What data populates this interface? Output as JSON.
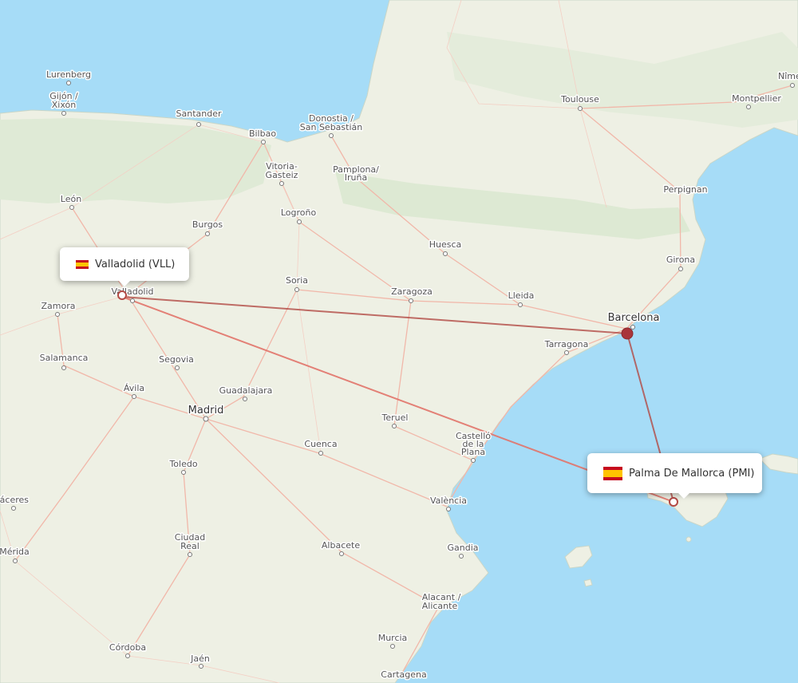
{
  "routes": [
    {
      "from": "Valladolid",
      "via": "Barcelona",
      "to": "Palma De Mallorca"
    },
    {
      "from": "Valladolid",
      "to": "Palma De Mallorca",
      "kind": "direct"
    }
  ],
  "airports": {
    "origin": {
      "label": "Valladolid (VLL)",
      "flag": "spain-flag-icon"
    },
    "destination": {
      "label": "Palma De Mallorca (PMI)",
      "flag": "spain-flag-icon"
    }
  },
  "hub": {
    "name": "Barcelona"
  },
  "cities": {
    "lurenberg": "Lurenberg",
    "gijon": "Gijón /",
    "xixon": "Xixón",
    "santander": "Santander",
    "bilbao": "Bilbao",
    "donostia": "Donostia /",
    "san_sebastian": "San Sebastián",
    "vitoria": "Vitoria-",
    "gasteiz": "Gasteiz",
    "pamplona": "Pamplona/",
    "iruna": "Iruña",
    "toulouse": "Toulouse",
    "montpellier": "Montpellier",
    "nimes": "Nîmes",
    "leon": "León",
    "burgos": "Burgos",
    "logrono": "Logroño",
    "huesca": "Huesca",
    "perpignan": "Perpignan",
    "girona": "Girona",
    "soria": "Soria",
    "zaragoza": "Zaragoza",
    "lleida": "Lleida",
    "barcelona": "Barcelona",
    "valladolid": "Valladolid",
    "zamora": "Zamora",
    "tarragona": "Tarragona",
    "salamanca": "Salamanca",
    "segovia": "Segovia",
    "avila": "Ávila",
    "guadalajara": "Guadalajara",
    "madrid": "Madrid",
    "teruel": "Teruel",
    "castello1": "Castelló",
    "castello2": "de la",
    "castello3": "Plana",
    "cuenca": "Cuenca",
    "toledo": "Toledo",
    "caceres": "Cáceres",
    "valencia": "València",
    "ciudad_real1": "Ciudad",
    "ciudad_real2": "Real",
    "albacete": "Albacete",
    "gandia": "Gandia",
    "merida": "Mérida",
    "alacant1": "Alacant /",
    "alacant2": "Alicante",
    "murcia": "Murcia",
    "cordoba": "Córdoba",
    "jaen": "Jaén",
    "cartagena": "Cartagena"
  },
  "colors": {
    "sea": "#a6dcf7",
    "land": "#eef0e4",
    "route": "#e2746b",
    "route_hub": "#b34a45",
    "hub_dot": "#a9353a"
  }
}
